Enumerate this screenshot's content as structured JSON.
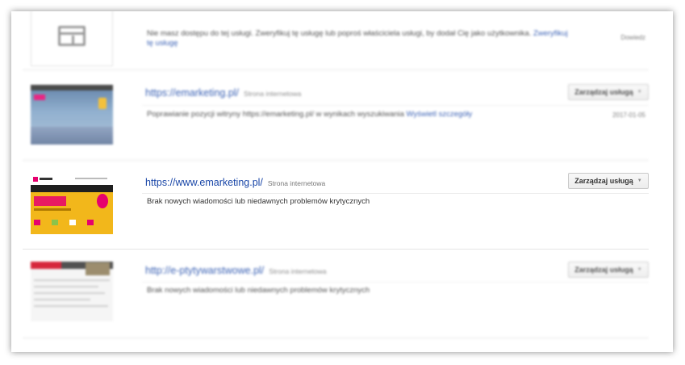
{
  "rows": [
    {
      "message": "Nie masz dostępu do tej usługi. Zweryfikuj tę usługę lub poproś właściciela usługi, by dodał Cię jako użytkownika.",
      "message_link": "Zweryfikuj tę usługę",
      "status": "Dowiedz"
    },
    {
      "url": "https://emarketing.pl/",
      "type": "Strona internetowa",
      "manage_label": "Zarządzaj usługą",
      "message": "Poprawianie pozycji witryny https://emarketing.pl/ w wynikach wyszukiwania",
      "message_link": "Wyświetl szczegóły",
      "date": "2017-01-05"
    },
    {
      "url": "https://www.emarketing.pl/",
      "type": "Strona internetowa",
      "manage_label": "Zarządzaj usługą",
      "message": "Brak nowych wiadomości lub niedawnych problemów krytycznych"
    },
    {
      "url": "http://e-ptytywarstwowe.pl/",
      "type": "Strona internetowa",
      "manage_label": "Zarządzaj usługą",
      "message": "Brak nowych wiadomości lub niedawnych problemów krytycznych"
    }
  ],
  "colors": {
    "link": "#1a47a8",
    "thumb_yellow": "#f2b71b",
    "brand_pink": "#e6006e"
  }
}
